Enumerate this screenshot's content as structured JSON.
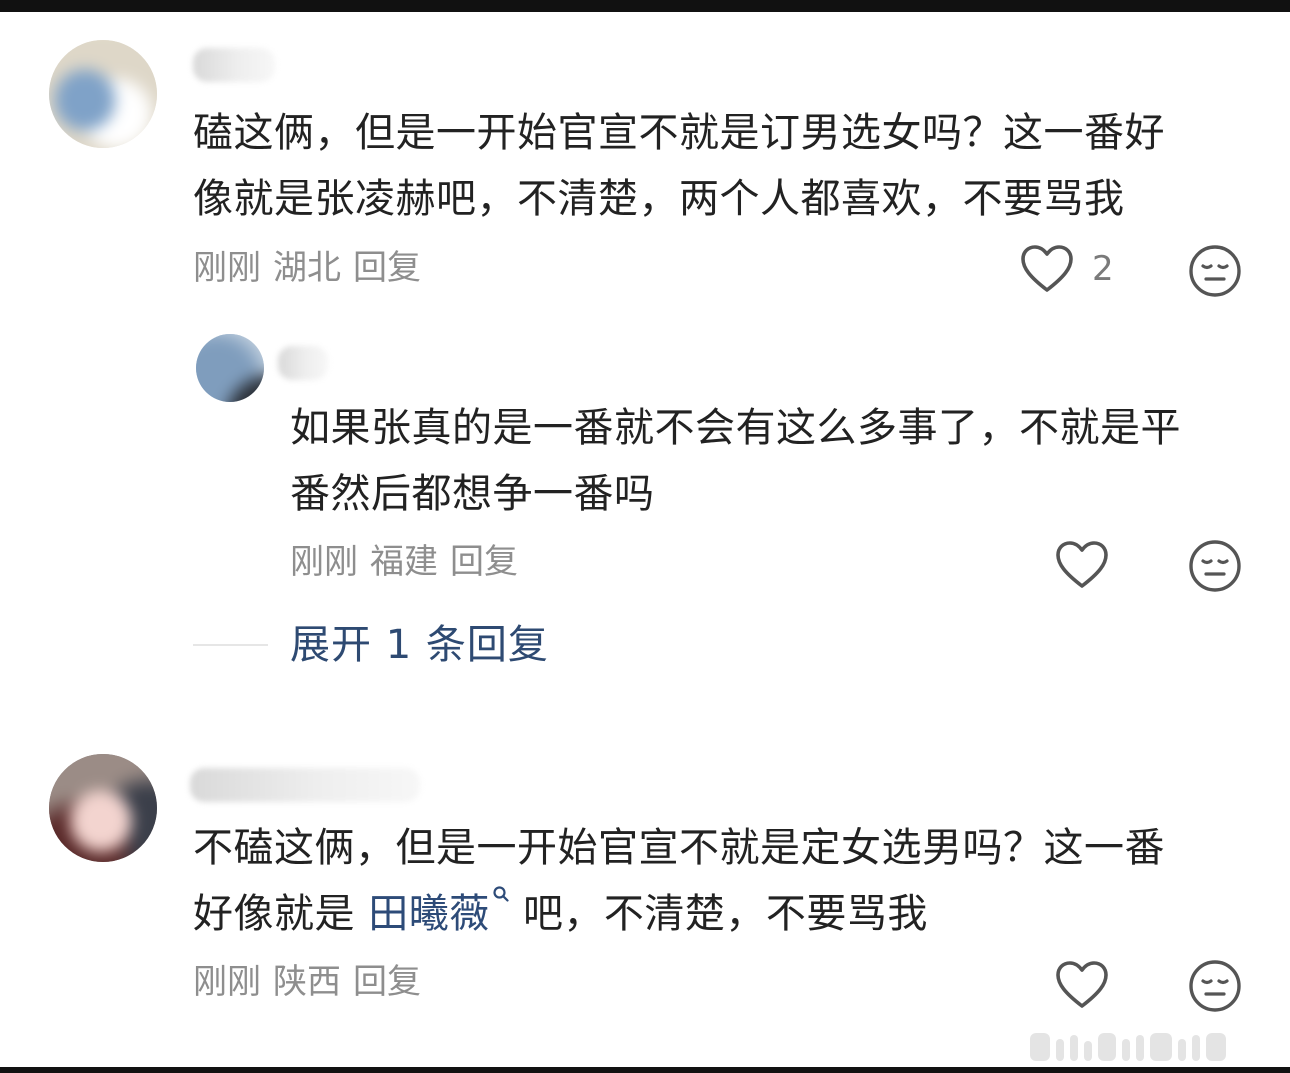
{
  "comments": [
    {
      "text_line1": "磕这俩，但是一开始官宣不就是订男选女吗？这一番好",
      "text_line2": "像就是张凌赫吧，不清楚，两个人都喜欢，不要骂我",
      "time": "刚刚",
      "location": "湖北",
      "reply_label": "回复",
      "likes": "2"
    },
    {
      "text_line1": "如果张真的是一番就不会有这么多事了，不就是平",
      "text_line2": "番然后都想争一番吗",
      "time": "刚刚",
      "location": "福建",
      "reply_label": "回复"
    },
    {
      "text_line1": "不磕这俩，但是一开始官宣不就是定女选男吗？这一番",
      "text_line2_before": "好像就是",
      "mention": "田曦薇",
      "text_line2_after": "吧，不清楚，不要骂我",
      "time": "刚刚",
      "location": "陕西",
      "reply_label": "回复"
    }
  ],
  "expand_replies": "展开 1 条回复",
  "icons": {
    "like": "heart-outline-icon",
    "emoji": "neutral-face-icon",
    "mention": "search-icon"
  },
  "colors": {
    "text": "#222222",
    "meta": "#8e8e8e",
    "link": "#2e4a72"
  }
}
